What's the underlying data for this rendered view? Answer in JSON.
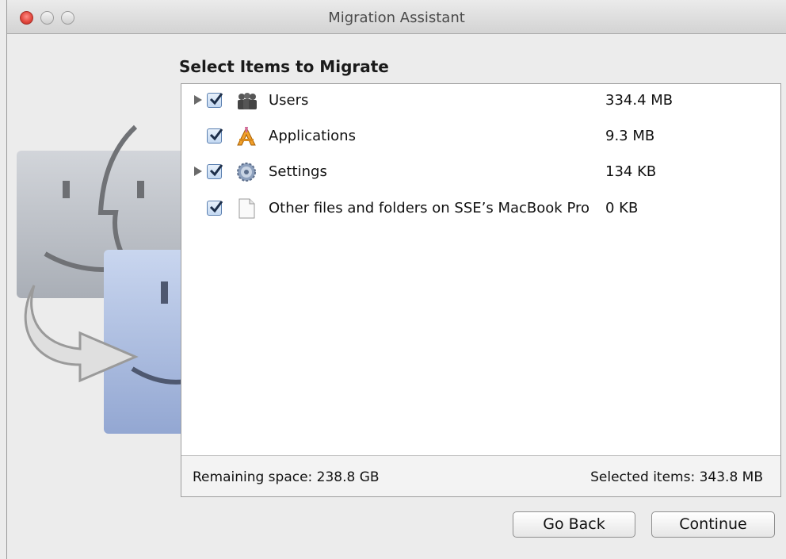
{
  "window": {
    "title": "Migration Assistant"
  },
  "main": {
    "heading": "Select Items to Migrate",
    "items": [
      {
        "label": "Users",
        "size": "334.4 MB",
        "checked": true,
        "expandable": true,
        "icon": "users-icon"
      },
      {
        "label": "Applications",
        "size": "9.3 MB",
        "checked": true,
        "expandable": false,
        "icon": "applications-icon"
      },
      {
        "label": "Settings",
        "size": "134 KB",
        "checked": true,
        "expandable": true,
        "icon": "settings-gear-icon"
      },
      {
        "label": "Other files and folders on SSE’s MacBook Pro",
        "size": "0 KB",
        "checked": true,
        "expandable": false,
        "icon": "document-icon"
      }
    ],
    "remaining_space": "Remaining space: 238.8 GB",
    "selected_items": "Selected items: 343.8 MB"
  },
  "buttons": {
    "go_back": "Go Back",
    "continue": "Continue"
  }
}
